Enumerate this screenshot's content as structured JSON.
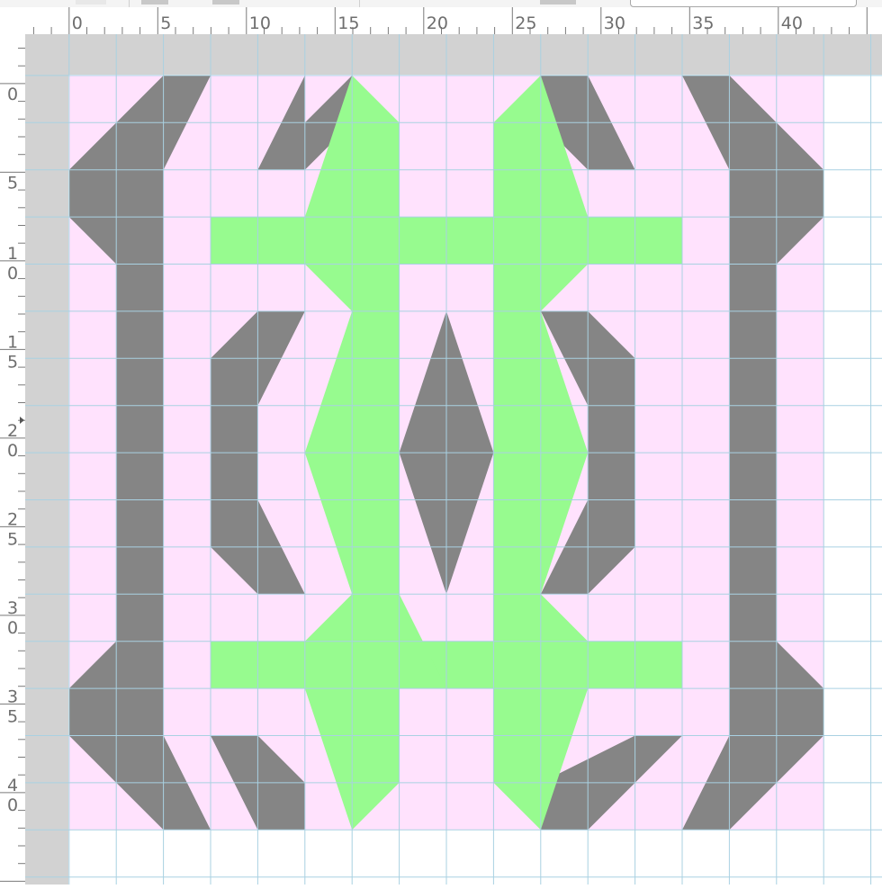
{
  "ruler": {
    "top_labels": [
      "0",
      "5",
      "10",
      "15",
      "20",
      "25",
      "30",
      "35",
      "40"
    ],
    "left_labels": [
      [
        "0"
      ],
      [
        "5"
      ],
      [
        "1",
        "0"
      ],
      [
        "1",
        "5"
      ],
      [
        "2",
        "0"
      ],
      [
        "2",
        "5"
      ],
      [
        "3",
        "0"
      ],
      [
        "3",
        "5"
      ],
      [
        "4",
        "0"
      ]
    ]
  },
  "colors": {
    "background": "#ffffff",
    "grey_band": "#d2d2d2",
    "quilt_background": "#ffe2fd",
    "gray_fabric": "#858585",
    "green_fabric": "#97fb8f",
    "grid_line": "#a9d1e2",
    "ruler_tick": "#7a7a7a"
  },
  "icons": {
    "lock": "lock-icon",
    "ruler_marker": "ruler-marker-icon"
  }
}
